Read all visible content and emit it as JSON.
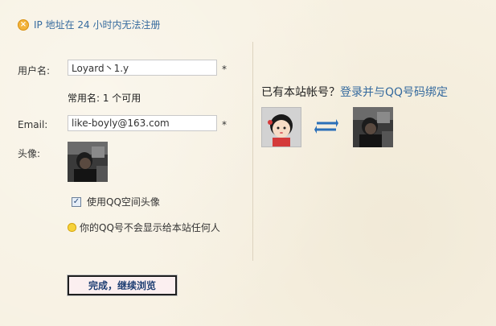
{
  "notice": {
    "text": "IP 地址在 24 小时内无法注册",
    "icon": "close-circle-icon"
  },
  "form": {
    "username_label": "用户名:",
    "username_value": "Loyard丶1.y",
    "required_mark": "*",
    "common_name_hint": "常用名: 1 个可用",
    "email_label": "Email:",
    "email_value": "like-boyly@163.com",
    "avatar_label": "头像:",
    "use_qq_avatar_label": "使用QQ空间头像",
    "use_qq_avatar_checked": true,
    "privacy_tip": "你的QQ号不会显示给本站任何人"
  },
  "right": {
    "prompt_text": "已有本站帐号？",
    "link_text": "登录并与QQ号码绑定"
  },
  "submit_label": "完成，继续浏览",
  "colors": {
    "link": "#356a9e",
    "background": "#f7f1e2"
  }
}
